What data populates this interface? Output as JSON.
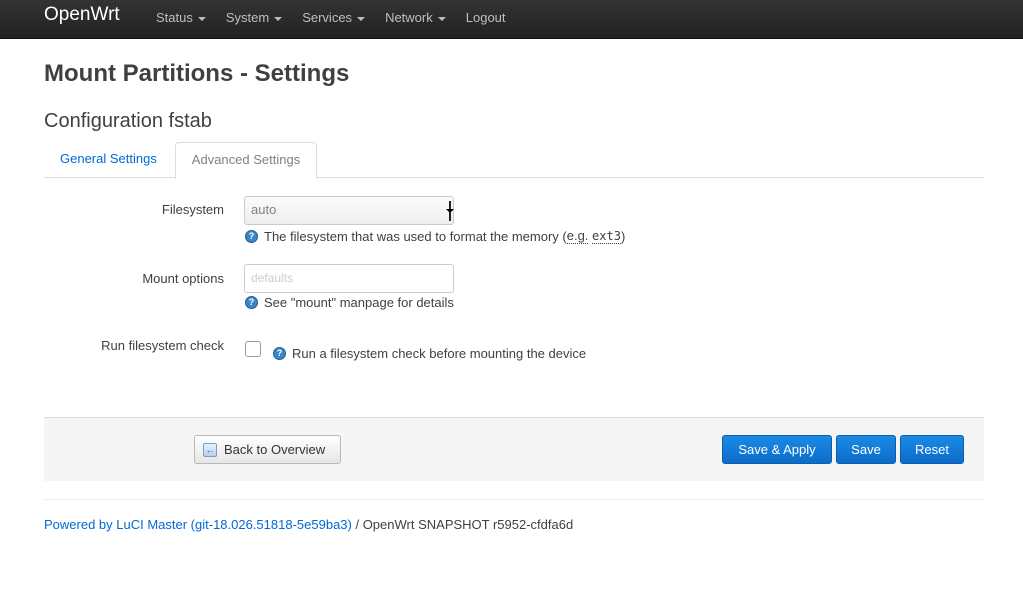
{
  "navbar": {
    "brand": "OpenWrt",
    "menu": [
      {
        "label": "Status",
        "has_caret": true
      },
      {
        "label": "System",
        "has_caret": true
      },
      {
        "label": "Services",
        "has_caret": true
      },
      {
        "label": "Network",
        "has_caret": true
      },
      {
        "label": "Logout",
        "has_caret": false
      }
    ]
  },
  "page": {
    "title": "Mount Partitions - Settings",
    "section_title": "Configuration fstab"
  },
  "tabs": [
    {
      "label": "General Settings",
      "active": false
    },
    {
      "label": "Advanced Settings",
      "active": true
    }
  ],
  "form": {
    "filesystem": {
      "label": "Filesystem",
      "value": "auto",
      "help_prefix": "The filesystem that was used to format the memory (",
      "help_abbr": "e.g.",
      "help_code": "ext3",
      "help_suffix": ")"
    },
    "mount_options": {
      "label": "Mount options",
      "placeholder": "defaults",
      "help": "See \"mount\" manpage for details"
    },
    "fs_check": {
      "label": "Run filesystem check",
      "checked": false,
      "help": "Run a filesystem check before mounting the device"
    },
    "help_icon_glyph": "?"
  },
  "actions": {
    "back_label": "Back to Overview",
    "save_apply_label": "Save & Apply",
    "save_label": "Save",
    "reset_label": "Reset",
    "primary_color": "#0d6cc7"
  },
  "footer": {
    "link_text": "Powered by LuCI Master (git-18.026.51818-5e59ba3)",
    "rest_text": " / OpenWrt SNAPSHOT r5952-cfdfa6d"
  }
}
